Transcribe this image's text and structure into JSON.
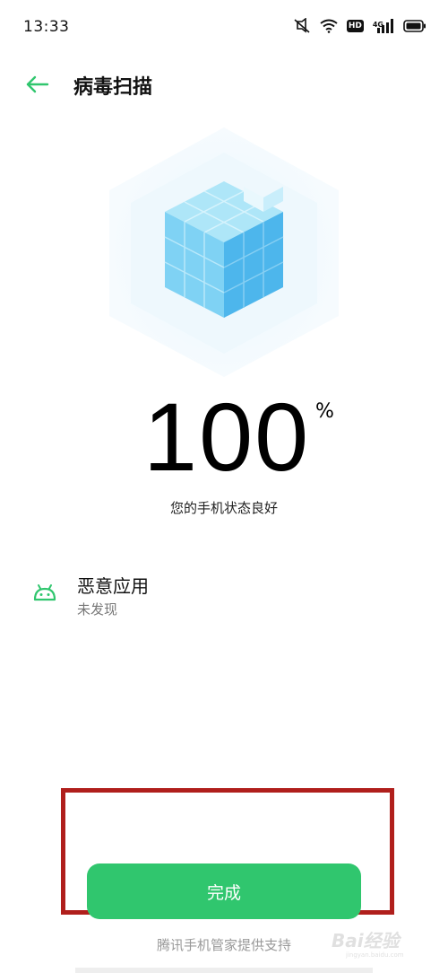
{
  "status_bar": {
    "time": "13:33",
    "icons": [
      "mute-vibrate-icon",
      "wifi-icon",
      "hd-icon",
      "signal-4g-icon",
      "battery-icon"
    ],
    "hd_label": "HD",
    "network_label": "4G"
  },
  "header": {
    "back_icon": "arrow-left-icon",
    "title": "病毒扫描"
  },
  "scan": {
    "percent": "100",
    "percent_sign": "%",
    "message": "您的手机状态良好"
  },
  "items": [
    {
      "icon": "android-icon",
      "title": "恶意应用",
      "subtitle": "未发现"
    }
  ],
  "actions": {
    "done_label": "完成"
  },
  "footer": {
    "support_text": "腾讯手机管家提供支持"
  },
  "watermark": {
    "text": "Bai经验",
    "sub": "jingyan.baidu.com"
  },
  "colors": {
    "accent": "#30c66e",
    "highlight_border": "#b01f1c",
    "cube_light": "#9fe0f7",
    "cube_dark": "#3aa9e8"
  }
}
